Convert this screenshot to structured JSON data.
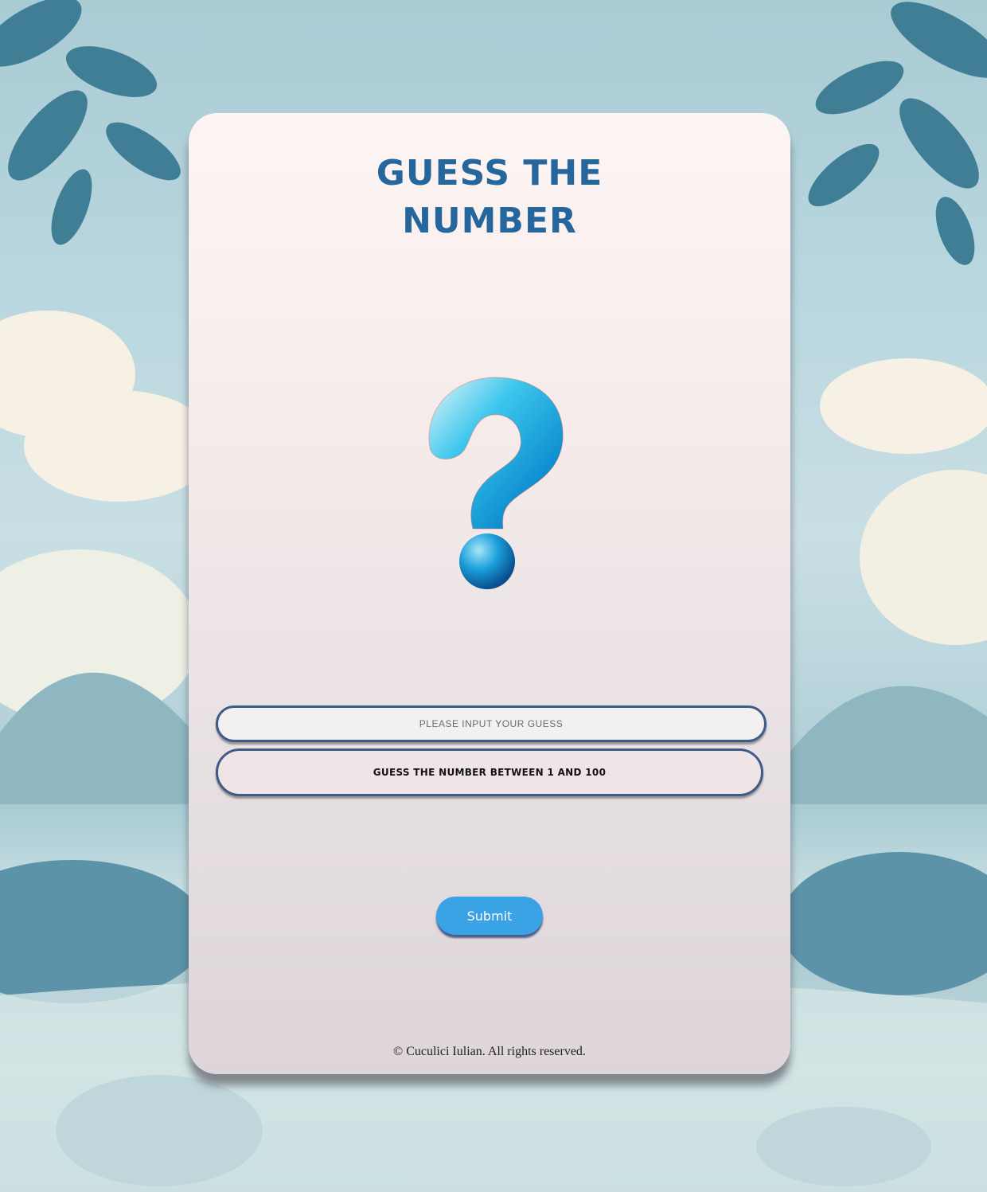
{
  "game": {
    "title_line1": "GUESS THE",
    "title_line2": "NUMBER",
    "input_placeholder": "PLEASE INPUT YOUR GUESS",
    "input_value": "",
    "message": "GUESS THE NUMBER BETWEEN 1 AND 100",
    "submit_label": "Submit",
    "footer": "© Cuculici Iulian. All rights reserved."
  },
  "icons": {
    "hero": "question-mark-icon"
  },
  "colors": {
    "title": "#25679c",
    "button": "#3aa3e6",
    "border": "#3f5b88"
  }
}
